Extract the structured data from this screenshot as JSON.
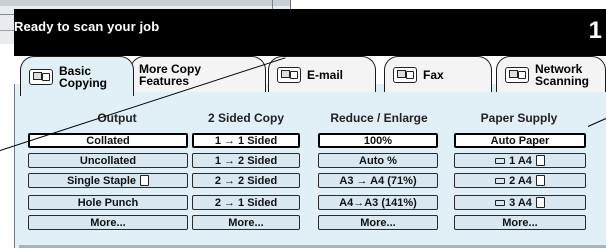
{
  "status": {
    "message": "Ready to scan your job",
    "copy_count": "1"
  },
  "tabs": [
    {
      "id": "basic",
      "line1": "Basic",
      "line2": "Copying",
      "active": true
    },
    {
      "id": "more",
      "line1": "More Copy",
      "line2": "Features",
      "active": false
    },
    {
      "id": "email",
      "line1": "E-mail",
      "line2": "",
      "active": false
    },
    {
      "id": "fax",
      "line1": "Fax",
      "line2": "",
      "active": false
    },
    {
      "id": "network",
      "line1": "Network",
      "line2": "Scanning",
      "active": false
    }
  ],
  "columns": {
    "output": {
      "header": "Output",
      "options": [
        "Collated",
        "Uncollated",
        "Single Staple",
        "Hole Punch",
        "More..."
      ],
      "selected": 0
    },
    "two_sided": {
      "header": "2 Sided Copy",
      "options": [
        "1 → 1 Sided",
        "1 → 2 Sided",
        "2 → 2 Sided",
        "2 → 1 Sided",
        "More..."
      ],
      "selected": 0
    },
    "reduce_enlarge": {
      "header": "Reduce / Enlarge",
      "options": [
        "100%",
        "Auto %",
        "A3 → A4 (71%)",
        "A4→A3 (141%)",
        "More..."
      ],
      "selected": 0
    },
    "paper_supply": {
      "header": "Paper Supply",
      "options": [
        "Auto Paper",
        "1 A4",
        "2 A4",
        "3 A4",
        "More..."
      ],
      "selected": 0
    }
  },
  "icons": {
    "tab_icon": "document-transfer-icon",
    "staple": "staple-sheet-icon",
    "tray": "paper-tray-icon",
    "portrait": "portrait-sheet-icon"
  }
}
